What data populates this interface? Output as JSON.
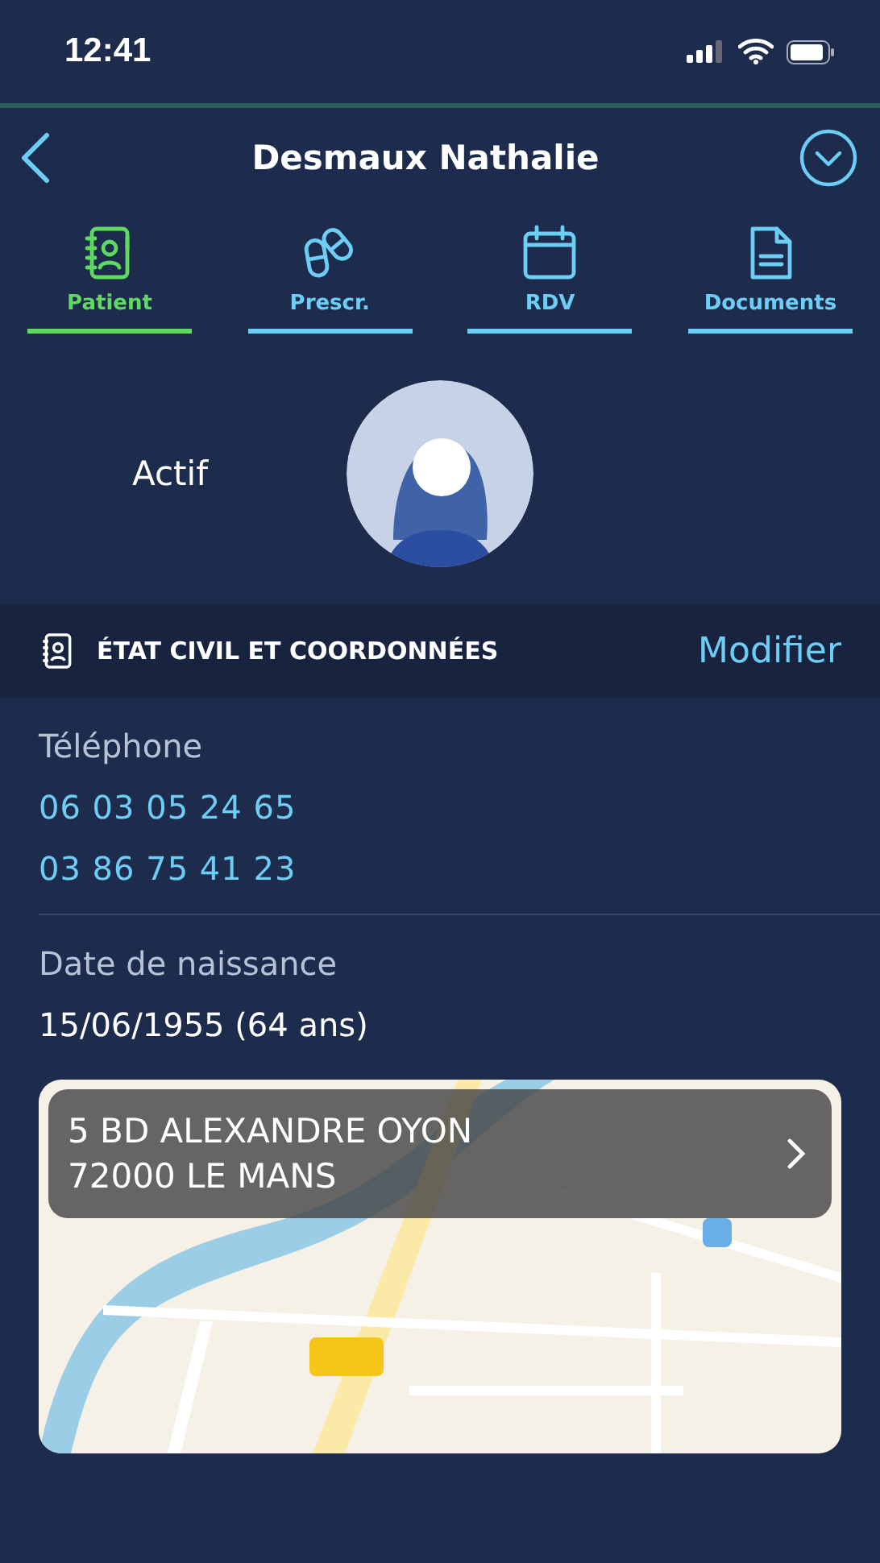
{
  "status_bar": {
    "time": "12:41"
  },
  "header": {
    "title": "Desmaux Nathalie"
  },
  "tabs": [
    {
      "label": "Patient",
      "kind": "contacts",
      "selected": true
    },
    {
      "label": "Prescr.",
      "kind": "pills",
      "selected": false
    },
    {
      "label": "RDV",
      "kind": "calendar",
      "selected": false
    },
    {
      "label": "Documents",
      "kind": "document",
      "selected": false
    }
  ],
  "profile": {
    "status": "Actif"
  },
  "section": {
    "title": "ÉTAT CIVIL ET COORDONNÉES",
    "action": "Modifier"
  },
  "fields": [
    {
      "label": "Téléphone",
      "kind": "links",
      "values": [
        "06 03 05 24 65",
        "03 86 75 41 23"
      ]
    },
    {
      "label": "Date de naissance",
      "kind": "text",
      "values": [
        "15/06/1955 (64 ans)"
      ]
    }
  ],
  "map": {
    "kind": "picture",
    "address": [
      "5 BD ALEXANDRE OYON",
      "72000 LE MANS"
    ]
  }
}
